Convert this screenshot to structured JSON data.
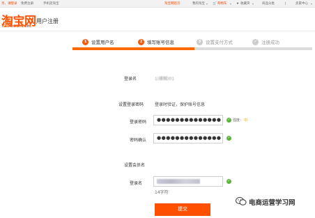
{
  "topbar": {
    "greeting": "亲，请登录",
    "register": "免费注册",
    "mobile": "手机逛淘宝",
    "home": "淘宝网首页",
    "my_taobao": "我的淘宝",
    "cart": "购物车",
    "favorites": "收藏夹",
    "categories": "商品分类",
    "seller_center": "卖家中心"
  },
  "header": {
    "logo": "淘宝网",
    "logo_sub": "Taobao.com",
    "title": "用户注册"
  },
  "steps": [
    {
      "number": "1",
      "label": "设置用户名",
      "state": "active"
    },
    {
      "number": "2",
      "label": "填写账号信息",
      "state": "active"
    },
    {
      "number": "3",
      "label": "设置支付方式",
      "state": "inactive"
    },
    {
      "number": "✓",
      "label": "注册成功",
      "state": "inactive"
    }
  ],
  "form": {
    "login_name_label": "登录名",
    "login_name_value": "1(模糊)01",
    "password_section_label": "设置登录密码",
    "password_section_hint": "登录时验证，保护账号信息",
    "password_label": "登录密码",
    "password_value": "●●●●●●●●●●●●●●",
    "strength_label": "强度：",
    "strength_value": "中",
    "confirm_label": "密码确认",
    "confirm_value": "●●●●●●●●●●●●●●",
    "member_section_label": "设置会员名",
    "member_name_label": "登录名",
    "member_name_hint": "14字符",
    "submit_label": "提交"
  },
  "watermark": {
    "text": "电商运营学习网"
  },
  "colors": {
    "brand": "#ff5000",
    "active_step": "#f55a0e",
    "success": "#5db33a"
  }
}
